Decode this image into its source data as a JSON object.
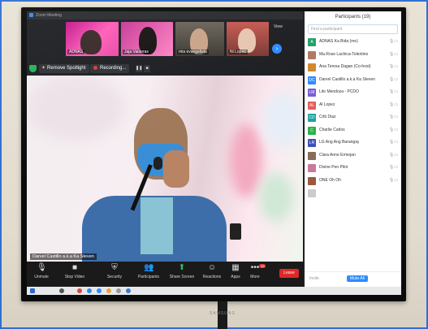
{
  "window": {
    "title": "Zoom Meeting"
  },
  "gallery": [
    {
      "name": "ADNAS",
      "bg": "#e84aa6"
    },
    {
      "name": "Jaja Valderas",
      "bg": "#ff86c5"
    },
    {
      "name": "mia evangelista",
      "bg": "#5a554b"
    },
    {
      "name": "Ni Lopez",
      "bg": "#a9493f"
    }
  ],
  "gallery_controls": {
    "view_label": "View",
    "next_icon": "chevron-right-icon"
  },
  "spotlight": {
    "remove_label": "Remove Spotlight",
    "recording_label": "Recording..."
  },
  "speaker": {
    "name": "Darvel Castillo a.k.a Ka Steven"
  },
  "toolbar": {
    "items": [
      {
        "label": "Unmute",
        "icon": "microphone-muted-icon"
      },
      {
        "label": "Stop Video",
        "icon": "video-camera-icon"
      },
      {
        "label": "Security",
        "icon": "shield-icon"
      },
      {
        "label": "Participants",
        "icon": "participants-icon"
      },
      {
        "label": "Share Screen",
        "icon": "share-screen-icon"
      },
      {
        "label": "Reactions",
        "icon": "reactions-icon"
      },
      {
        "label": "Apps",
        "icon": "apps-icon"
      },
      {
        "label": "More",
        "icon": "more-icon"
      }
    ],
    "more_badge": "10",
    "leave_label": "Leave"
  },
  "participants": {
    "title": "Participants (19)",
    "search_placeholder": "Find a participant",
    "list": [
      {
        "initials": "A",
        "name": "ADNAS Ka Bida (me)",
        "color": "#22a06b"
      },
      {
        "initials": "",
        "name": "Ma.Rose Lachica-Tolentino",
        "color": "#b07a62"
      },
      {
        "initials": "",
        "name": "Ana Teresa Dagan (Co-host)",
        "color": "#d08a2e"
      },
      {
        "initials": "DC",
        "name": "Darvel Castillo a.k.a Ka Steven",
        "color": "#2d8cff"
      },
      {
        "initials": "LM",
        "name": "Lito Mendoza - PCDO",
        "color": "#7b5cd6"
      },
      {
        "initials": "AL",
        "name": "Al Lopez",
        "color": "#e25d5d"
      },
      {
        "initials": "CD",
        "name": "Crib Diaz",
        "color": "#1fa3a3"
      },
      {
        "initials": "C",
        "name": "Charlie Carlos",
        "color": "#2bb24c"
      },
      {
        "initials": "LR",
        "name": "LG Ang Ang Barangay",
        "color": "#3f51b5"
      },
      {
        "initials": "",
        "name": "Clara Anne Ermejan",
        "color": "#8a6a5a"
      },
      {
        "initials": "",
        "name": "Divine Pen Pilot",
        "color": "#c9799a"
      },
      {
        "initials": "",
        "name": "ONE Oh Oh",
        "color": "#9b5a3c"
      },
      {
        "initials": "",
        "name": "",
        "color": "#cccccc"
      }
    ],
    "invite_label": "Invite",
    "mute_all_label": "Mute All"
  },
  "tv": {
    "brand": "SAMSUNG"
  }
}
